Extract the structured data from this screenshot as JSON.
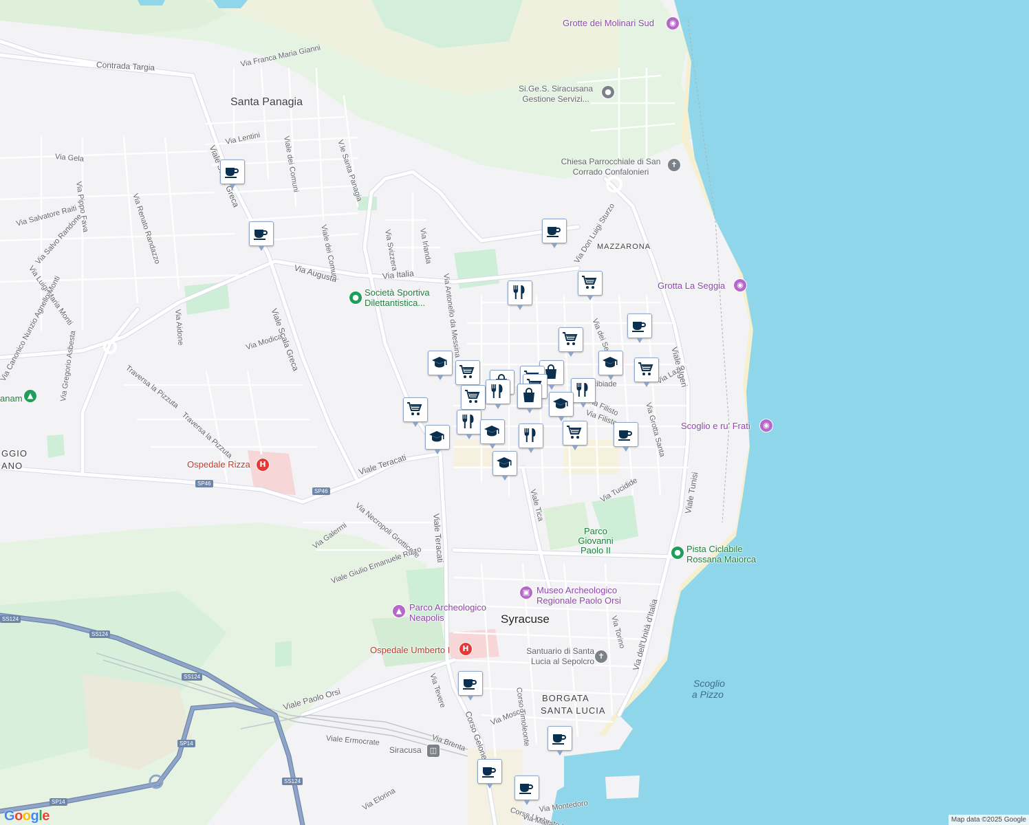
{
  "map": {
    "city_label": "Syracuse",
    "attribution": "Map data ©2025 Google",
    "logo": "Google",
    "logo_colors": [
      "#4285F4",
      "#EA4335",
      "#FBBC05",
      "#4285F4",
      "#34A853",
      "#EA4335"
    ],
    "colors": {
      "water": "#8fd6ea",
      "land": "#f3f3f5",
      "green": "#cfeed8",
      "beach": "#f6efd0",
      "road": "#ffffff",
      "highway": "#8ea4c8",
      "marker_fill": "#0b2f4e",
      "marker_border": "#8ea4c8"
    },
    "districts": [
      {
        "text": "Santa Panagia"
      },
      {
        "text": "MAZZARONA"
      },
      {
        "text": "BORGATA"
      },
      {
        "text": "SANTA LUCIA"
      },
      {
        "text": "GGIO"
      },
      {
        "text": "ANO"
      }
    ],
    "sea_labels": [
      {
        "text": "Scoglio"
      },
      {
        "text": "a Pizzo"
      }
    ],
    "streets": [
      {
        "text": "Contrada Targia"
      },
      {
        "text": "Via Franca Maria Gianni"
      },
      {
        "text": "Via Lentini"
      },
      {
        "text": "Viale dei Comuni"
      },
      {
        "text": "V.le Santa Panagia"
      },
      {
        "text": "Via Gela"
      },
      {
        "text": "Via Pippo Fava"
      },
      {
        "text": "Via Renato Randazzo"
      },
      {
        "text": "Via Salvatore Raiti"
      },
      {
        "text": "Via Salvo Randone"
      },
      {
        "text": "Via Luigi Maria Monti"
      },
      {
        "text": "Via Canonico Nunzio Agnello Monti"
      },
      {
        "text": "Via Gregorio Asbesta"
      },
      {
        "text": "Via Aidone"
      },
      {
        "text": "Via Modica"
      },
      {
        "text": "Viale Scala Greca"
      },
      {
        "text": "Viale Scala Greca"
      },
      {
        "text": "Viale dei Comuni"
      },
      {
        "text": "Via Svizzera"
      },
      {
        "text": "Via Irlanda"
      },
      {
        "text": "Via Italia"
      },
      {
        "text": "Via Augusta"
      },
      {
        "text": "Via Antonello da Messina"
      },
      {
        "text": "Via Don Luigi Sturzo"
      },
      {
        "text": "Via dei Servi"
      },
      {
        "text": "Viale Algeri"
      },
      {
        "text": "Viale Tunisi"
      },
      {
        "text": "Traversa la Pizzuta"
      },
      {
        "text": "Traversa la Pizzuta"
      },
      {
        "text": "Viale Teracati"
      },
      {
        "text": "Viale Teracati"
      },
      {
        "text": "Via Necropoli Grotticelle"
      },
      {
        "text": "Via Galermi"
      },
      {
        "text": "Viale Giulio Emanuele Rizzo"
      },
      {
        "text": "Viale Tica"
      },
      {
        "text": "Via Tucidide"
      },
      {
        "text": "Via Filisto"
      },
      {
        "text": "Via Grotta Santa"
      },
      {
        "text": "Via Lazio"
      },
      {
        "text": "Via Torino"
      },
      {
        "text": "Via dell'Unità d'Italia"
      },
      {
        "text": "Viale Paolo Orsi"
      },
      {
        "text": "Viale Ermocrate"
      },
      {
        "text": "Via Tevere"
      },
      {
        "text": "Corso Gelone"
      },
      {
        "text": "Via Brenta"
      },
      {
        "text": "Via Mosco"
      },
      {
        "text": "Corso Timoleonte"
      },
      {
        "text": "Via Elorina"
      },
      {
        "text": "Via Montedoro"
      },
      {
        "text": "Corso Umberto I"
      },
      {
        "text": "Via Malta"
      },
      {
        "text": "Via Filisto"
      },
      {
        "text": "Alcibiade"
      }
    ],
    "shields": [
      {
        "text": "SP46"
      },
      {
        "text": "SP46"
      },
      {
        "text": "SS124"
      },
      {
        "text": "SS124"
      },
      {
        "text": "SS124"
      },
      {
        "text": "SP14"
      },
      {
        "text": "SP14"
      }
    ],
    "pois": [
      {
        "name": "Grotte dei Molinari Sud",
        "icon": "camera-icon"
      },
      {
        "name": "Si.Ge.S. Siracusana Gestione Servizi...",
        "icon": "place-icon"
      },
      {
        "name": "Chiesa Parrocchiale di San Corrado Confalonieri",
        "icon": "church-icon"
      },
      {
        "name": "Grotta La Seggia",
        "icon": "camera-icon"
      },
      {
        "name": "Società Sportiva Dilettantistica...",
        "icon": "place-icon"
      },
      {
        "name": "Scoglio e ru' Frati",
        "icon": "camera-icon"
      },
      {
        "name": "Ospedale Rizza",
        "icon": "hospital-icon"
      },
      {
        "name": "Parco Giovanni Paolo II",
        "icon": "park-icon"
      },
      {
        "name": "Pista Ciclabile Rossana Maiorca",
        "icon": "place-icon"
      },
      {
        "name": "Museo Archeologico Regionale Paolo Orsi",
        "icon": "museum-icon"
      },
      {
        "name": "Parco Archeologico Neapolis",
        "icon": "monument-icon"
      },
      {
        "name": "Ospedale Umberto I",
        "icon": "hospital-icon"
      },
      {
        "name": "Santuario di Santa Lucia al Sepolcro",
        "icon": "church-icon"
      },
      {
        "name": "Siracusa",
        "icon": "train-icon"
      },
      {
        "name": "anam",
        "icon": "tree-icon"
      }
    ],
    "markers": [
      {
        "type": "cafe"
      },
      {
        "type": "cafe"
      },
      {
        "type": "cafe"
      },
      {
        "type": "restaurant"
      },
      {
        "type": "grocery"
      },
      {
        "type": "cafe"
      },
      {
        "type": "grocery"
      },
      {
        "type": "school"
      },
      {
        "type": "grocery"
      },
      {
        "type": "grocery"
      },
      {
        "type": "school"
      },
      {
        "type": "grocery"
      },
      {
        "type": "shopping"
      },
      {
        "type": "shopping"
      },
      {
        "type": "shopping"
      },
      {
        "type": "grocery"
      },
      {
        "type": "grocery"
      },
      {
        "type": "restaurant"
      },
      {
        "type": "shopping"
      },
      {
        "type": "restaurant"
      },
      {
        "type": "school"
      },
      {
        "type": "restaurant"
      },
      {
        "type": "grocery"
      },
      {
        "type": "school"
      },
      {
        "type": "school"
      },
      {
        "type": "restaurant"
      },
      {
        "type": "grocery"
      },
      {
        "type": "cafe"
      },
      {
        "type": "school"
      },
      {
        "type": "cafe"
      },
      {
        "type": "cafe"
      },
      {
        "type": "cafe"
      },
      {
        "type": "cafe"
      }
    ]
  }
}
